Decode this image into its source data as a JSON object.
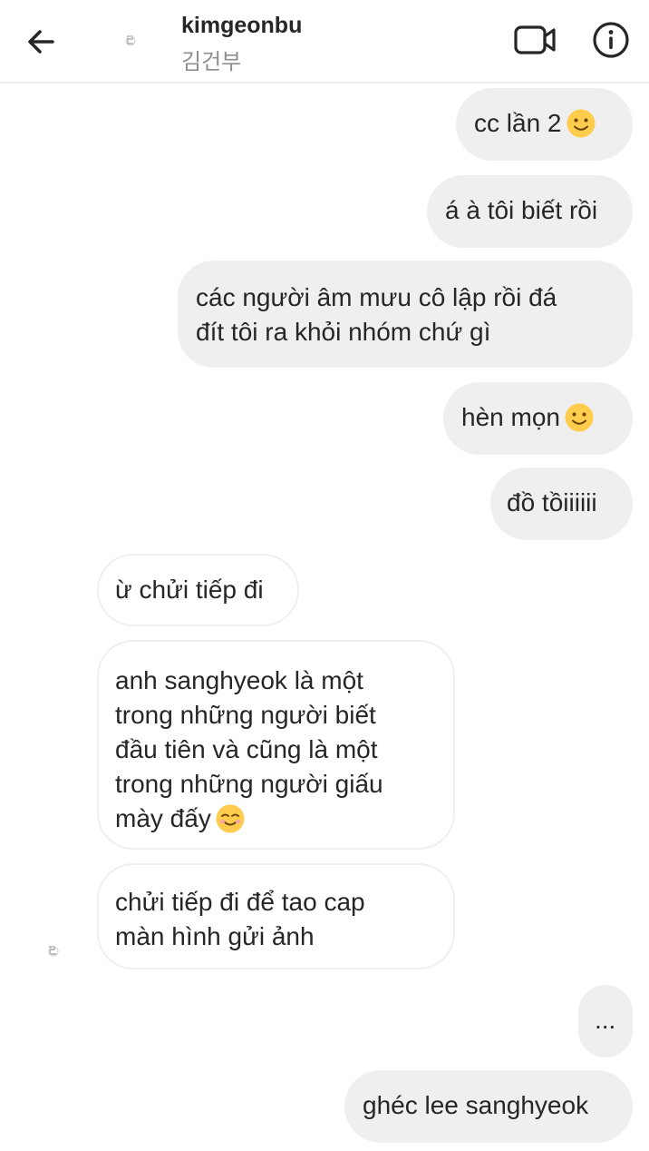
{
  "header": {
    "username": "kimgeonbu",
    "subtitle": "김건부"
  },
  "messages": [
    {
      "from": "me",
      "text": "cc lần 2",
      "emoji": "slightly-smiling-face"
    },
    {
      "from": "me",
      "text": "á à tôi biết rồi"
    },
    {
      "from": "me",
      "lines": [
        "các người âm mưu cô lập rồi đá",
        "đít tôi ra khỏi nhóm chứ gì"
      ]
    },
    {
      "from": "me",
      "text": "hèn mọn",
      "emoji": "slightly-smiling-face"
    },
    {
      "from": "me",
      "text": "đồ tồiiiiii"
    },
    {
      "from": "them",
      "text": "ừ chửi tiếp đi"
    },
    {
      "from": "them",
      "lines": [
        "anh sanghyeok là một",
        "trong những người biết",
        "đầu tiên và cũng là một",
        "trong những người giấu",
        "mày đấy"
      ],
      "emoji": "smiling-face"
    },
    {
      "from": "them",
      "lines": [
        "chửi tiếp đi để tao cap",
        "màn hình gửi ảnh"
      ]
    },
    {
      "from": "me",
      "text": "..."
    },
    {
      "from": "me",
      "text": "ghéc lee sanghyeok"
    }
  ],
  "icons": {
    "back": "arrow-left-icon",
    "video": "video-camera-icon",
    "info": "info-icon",
    "emoji_smile": "slightly-smiling-face-icon",
    "emoji_blush": "smiling-face-icon"
  },
  "colors": {
    "outgoing_bubble": "#efefef",
    "incoming_border": "#efefef",
    "subtitle": "#8e8e8e",
    "emoji_yellow": "#ffcc4d"
  }
}
